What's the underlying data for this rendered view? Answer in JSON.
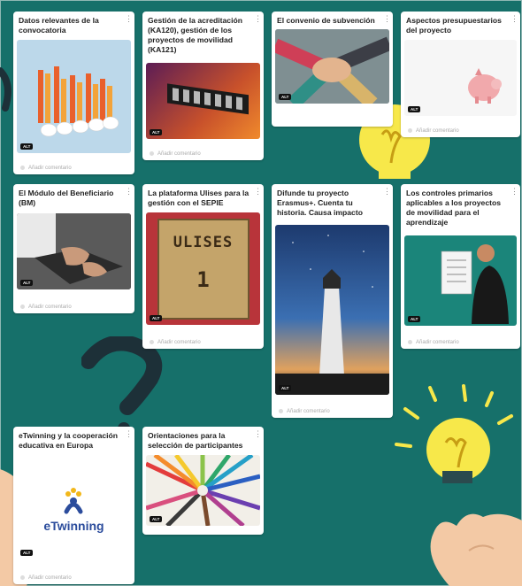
{
  "colors": {
    "background": "#16706a",
    "card": "#ffffff",
    "bulb": "#f7e84a",
    "decor_dark": "#1d3038"
  },
  "icons": {
    "card_menu": "kebab-menu-icon",
    "comment": "comment-icon"
  },
  "common": {
    "alt_badge": "ALT",
    "comment_placeholder": "Añadir comentario",
    "menu_glyph": "⋮"
  },
  "cards": [
    {
      "title": "Datos relevantes de la convocatoria",
      "image": "bar-chart-with-percentages"
    },
    {
      "title": "Gestión de la acreditación (KA120), gestión de los proyectos de movilidad (KA121)",
      "image": "projects-sign"
    },
    {
      "title": "El convenio de subvención",
      "image": "stacked-hands"
    },
    {
      "title": "Aspectos presupuestarios del proyecto",
      "image": "piggy-bank"
    },
    {
      "title": "El Módulo del Beneficiario (BM)",
      "image": "typing-laptop"
    },
    {
      "title": "La plataforma Ulises para la gestión con el SEPIE",
      "image": "ulises-book",
      "image_text": {
        "line1": "ULISES",
        "line2": "1"
      }
    },
    {
      "title": "Difunde tu proyecto Erasmus+. Cuenta tu historia. Causa impacto",
      "image": "lighthouse-starry-sky"
    },
    {
      "title": "Los controles primarios aplicables a los proyectos de movilidad para el aprendizaje",
      "image": "person-with-checklist"
    },
    {
      "title": "eTwinning y la cooperación educativa en Europa",
      "image": "etwinning-logo",
      "image_text": {
        "logo": "eTwinning"
      }
    },
    {
      "title": "Orientaciones para la selección de participantes",
      "image": "colored-pencils"
    }
  ]
}
